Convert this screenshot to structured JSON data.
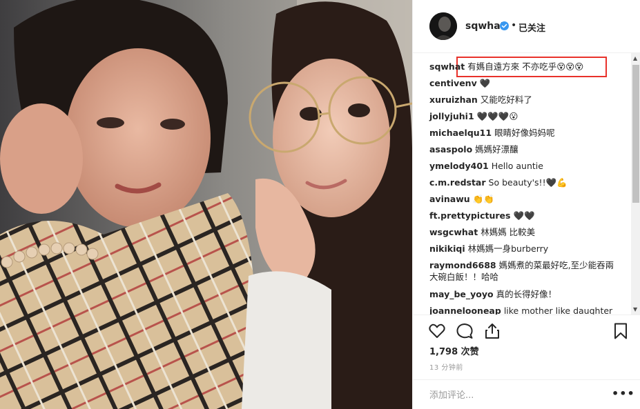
{
  "post": {
    "username": "sqwhat",
    "separator": "•",
    "follow_status": "已关注"
  },
  "comments": [
    {
      "user": "sqwhat",
      "text": "有媽自遠方來 不亦吃乎😵😵😵"
    },
    {
      "user": "centivenv",
      "text": "🖤"
    },
    {
      "user": "xuruizhan",
      "text": "又能吃好料了"
    },
    {
      "user": "jollyjuhi1",
      "text": "🖤🖤🖤😮"
    },
    {
      "user": "michaelqu11",
      "text": "眼睛好像妈妈呢"
    },
    {
      "user": "asaspolo",
      "text": "媽媽好漂釀"
    },
    {
      "user": "ymelody401",
      "text": "Hello auntie"
    },
    {
      "user": "c.m.redstar",
      "text": "So beauty's!!🖤💪"
    },
    {
      "user": "avinawu",
      "text": "👏👏"
    },
    {
      "user": "ft.prettypictures",
      "text": "🖤🖤"
    },
    {
      "user": "wsgcwhat",
      "text": "林媽媽 比較美"
    },
    {
      "user": "nikikiqi",
      "text": "林媽媽一身burberry"
    },
    {
      "user": "raymond6688",
      "text": "媽媽煮的菜最好吃,至少能吞兩大碗白飯！！哈哈"
    },
    {
      "user": "may_be_yoyo",
      "text": "真的长得好像！"
    },
    {
      "user": "joannelooneap",
      "text": "like mother like daughter"
    }
  ],
  "stats": {
    "likes": "1,798 次赞",
    "time": "13 分钟前"
  },
  "composer": {
    "placeholder": "添加评论...",
    "more": "•••"
  },
  "icons": {
    "like": "heart-icon",
    "comment": "comment-icon",
    "share": "share-icon",
    "save": "bookmark-icon",
    "verified": "verified-badge-icon"
  },
  "colors": {
    "highlight_border": "#e8312a",
    "verified_blue": "#3897f0",
    "muted_text": "#999999"
  }
}
